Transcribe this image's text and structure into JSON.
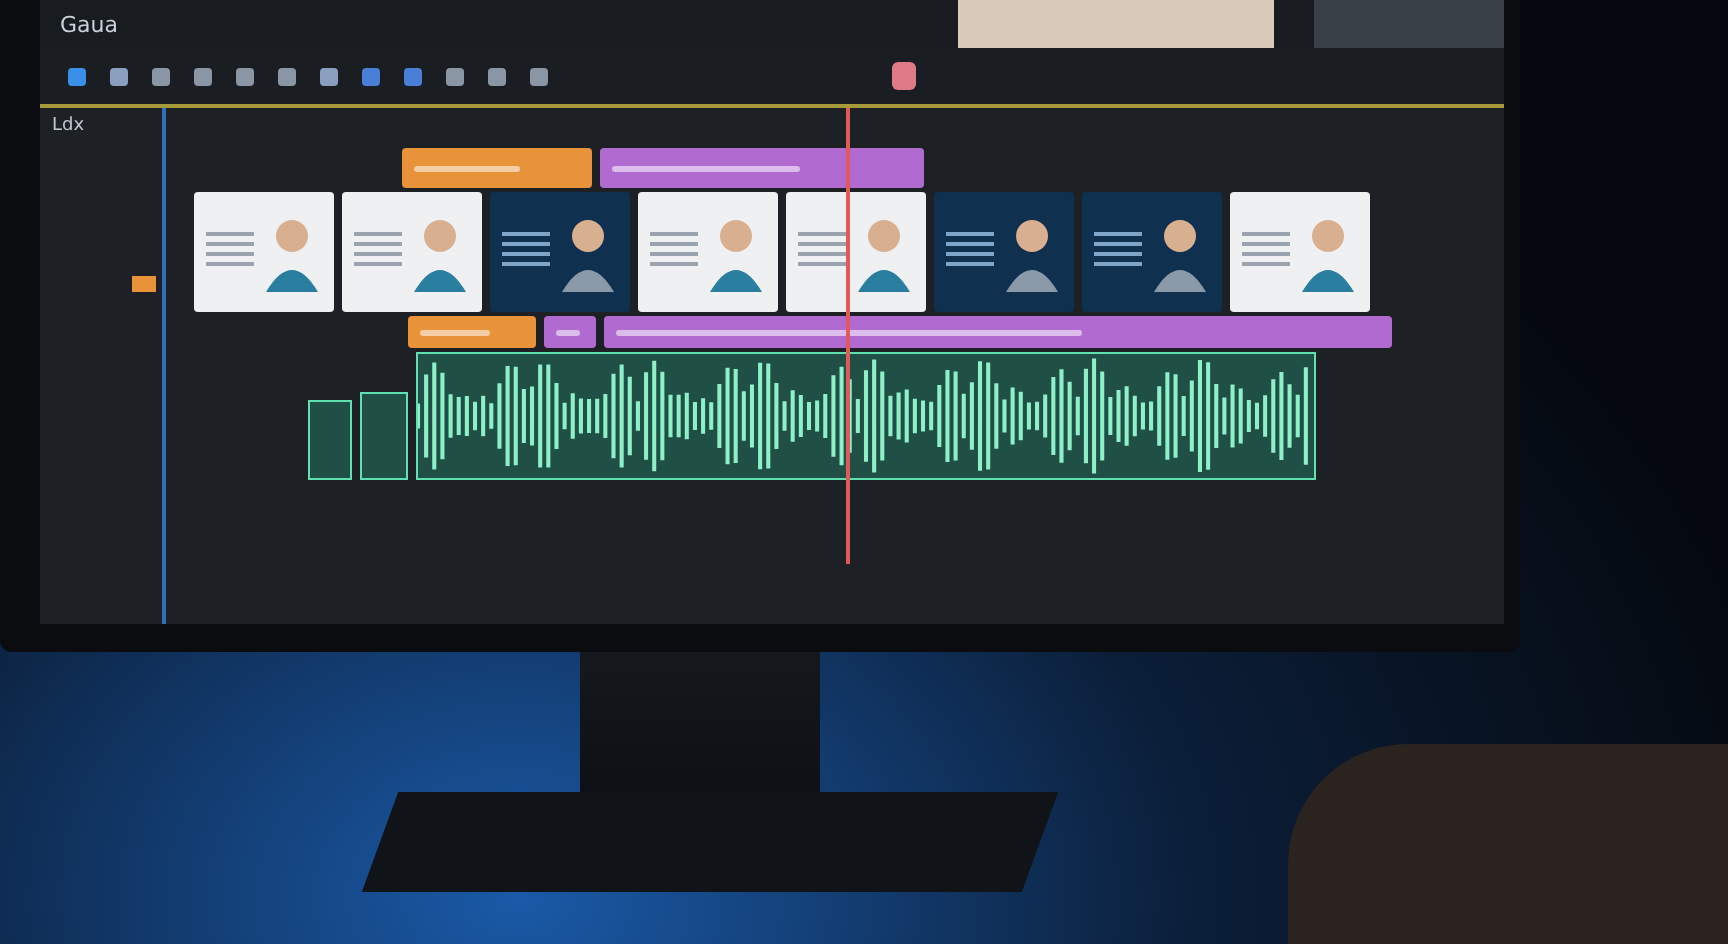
{
  "window": {
    "title": "Gaua"
  },
  "track_label": "Ldx",
  "title_clips": [
    {
      "color": "#e8923a"
    },
    {
      "color": "#b06ad0"
    }
  ],
  "slides": [
    {
      "kind": "light"
    },
    {
      "kind": "light"
    },
    {
      "kind": "dark"
    },
    {
      "kind": "light"
    },
    {
      "kind": "light"
    },
    {
      "kind": "dark"
    },
    {
      "kind": "dark"
    },
    {
      "kind": "light"
    }
  ],
  "sub_clips": [
    {
      "color": "#e8923a"
    },
    {
      "color": "#b06ad0"
    },
    {
      "color": "#b06ad0"
    }
  ],
  "audio_clips": [
    {
      "kind": "small"
    },
    {
      "kind": "small"
    },
    {
      "kind": "wave"
    }
  ]
}
